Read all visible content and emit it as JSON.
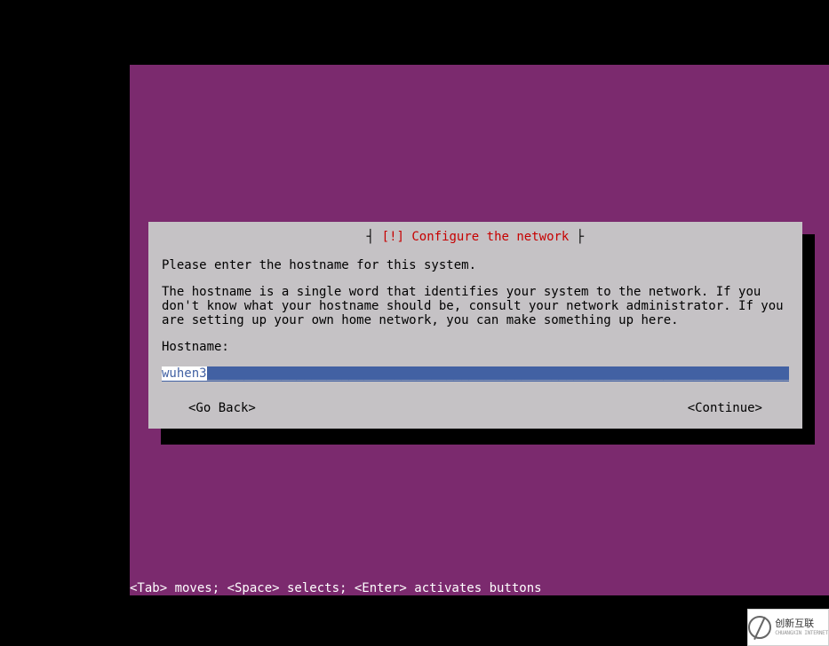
{
  "installer": {
    "dialog": {
      "title": "[!] Configure the network",
      "prompt": "Please enter the hostname for this system.",
      "description": "The hostname is a single word that identifies your system to the network. If you don't know what your hostname should be, consult your network administrator. If you are setting up your own home network, you can make something up here.",
      "field_label": "Hostname:",
      "input_value": "wuhen3",
      "go_back": "<Go Back>",
      "continue": "<Continue>"
    },
    "helpbar": "<Tab> moves; <Space> selects; <Enter> activates buttons"
  },
  "watermark": {
    "brand": "创新互联",
    "sub": "CHUANGXIN INTERNET"
  }
}
